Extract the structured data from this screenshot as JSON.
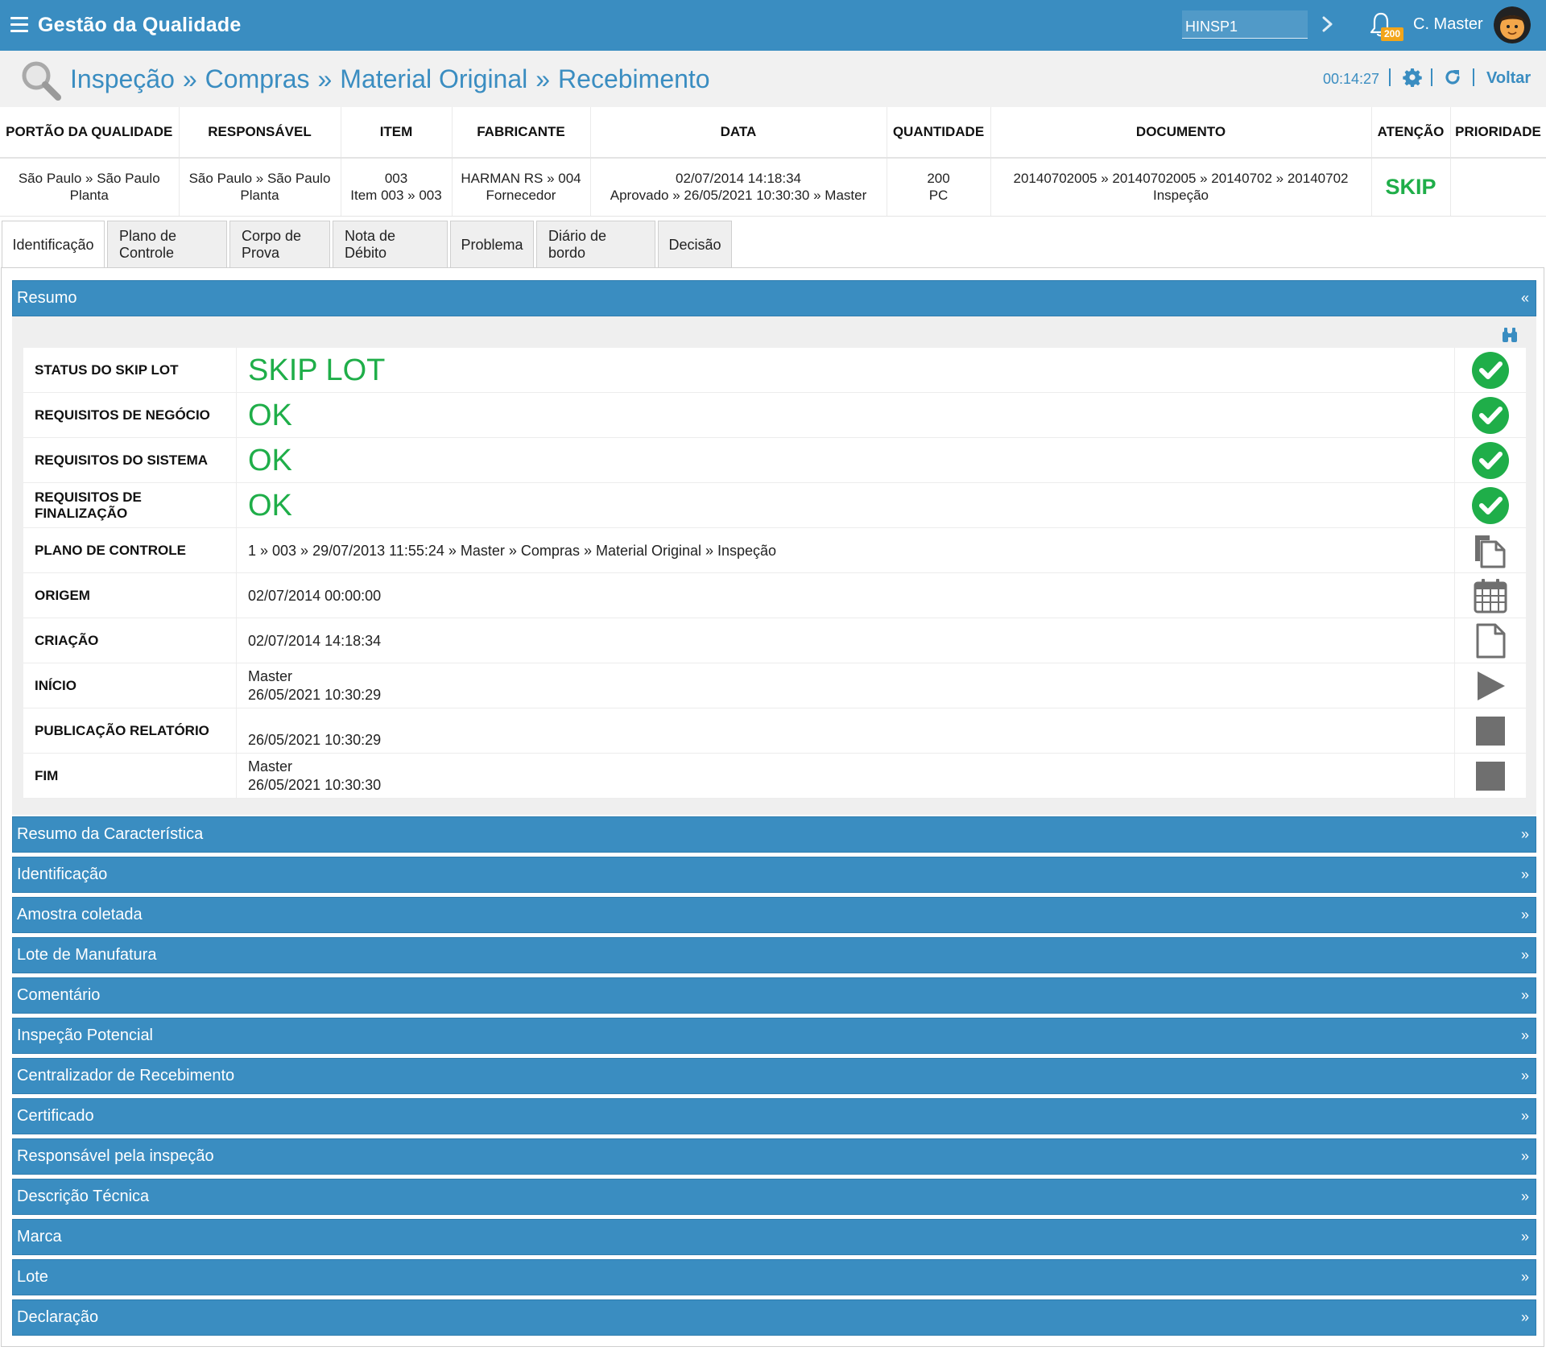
{
  "app": {
    "title": "Gestão da Qualidade",
    "company": "HINSP1",
    "notifications": "200",
    "user": "C. Master"
  },
  "breadcrumb": {
    "items": [
      "Inspeção",
      "Compras",
      "Material Original",
      "Recebimento"
    ],
    "separator": "»",
    "timer": "00:14:27",
    "back": "Voltar"
  },
  "summary": {
    "headers": [
      "PORTÃO DA QUALIDADE",
      "RESPONSÁVEL",
      "ITEM",
      "FABRICANTE",
      "DATA",
      "QUANTIDADE",
      "DOCUMENTO",
      "ATENÇÃO",
      "PRIORIDADE"
    ],
    "gate": {
      "l1": "São Paulo » São Paulo",
      "l2": "Planta"
    },
    "responsible": {
      "l1": "São Paulo » São Paulo",
      "l2": "Planta"
    },
    "item": {
      "l1": "003",
      "l2": "Item 003 » 003"
    },
    "manufacturer": {
      "l1": "HARMAN RS » 004",
      "l2": "Fornecedor"
    },
    "date": {
      "l1": "02/07/2014 14:18:34",
      "l2": "Aprovado » 26/05/2021 10:30:30 » Master"
    },
    "quantity": {
      "l1": "200",
      "l2": "PC"
    },
    "document": {
      "l1": "20140702005 » 20140702005 » 20140702 » 20140702",
      "l2": "Inspeção"
    },
    "attention": "SKIP",
    "priority": ""
  },
  "tabs": [
    "Identificação",
    "Plano de Controle",
    "Corpo de Prova",
    "Nota de Débito",
    "Problema",
    "Diário de bordo",
    "Decisão"
  ],
  "resumo": {
    "title": "Resumo",
    "collapse": "«",
    "rows": [
      {
        "label": "STATUS DO SKIP LOT",
        "value": "SKIP LOT",
        "icon": "check-circle-icon"
      },
      {
        "label": "REQUISITOS DE NEGÓCIO",
        "value": "OK",
        "icon": "check-circle-icon"
      },
      {
        "label": "REQUISITOS DO SISTEMA",
        "value": "OK",
        "icon": "check-circle-icon"
      },
      {
        "label": "REQUISITOS DE FINALIZAÇÃO",
        "value": "OK",
        "icon": "check-circle-icon"
      },
      {
        "label": "PLANO DE CONTROLE",
        "value": "1 » 003 » 29/07/2013 11:55:24 » Master » Compras » Material Original » Inspeção",
        "icon": "copy-icon"
      },
      {
        "label": "ORIGEM",
        "value": "02/07/2014 00:00:00",
        "icon": "calendar-icon"
      },
      {
        "label": "CRIAÇÃO",
        "value": "02/07/2014 14:18:34",
        "icon": "file-icon"
      },
      {
        "label": "INÍCIO",
        "l1": "Master",
        "l2": "26/05/2021 10:30:29",
        "icon": "play-icon"
      },
      {
        "label": "PUBLICAÇÃO RELATÓRIO",
        "l1": "",
        "l2": "26/05/2021 10:30:29",
        "icon": "stop-icon"
      },
      {
        "label": "FIM",
        "l1": "Master",
        "l2": "26/05/2021 10:30:30",
        "icon": "stop-icon"
      }
    ]
  },
  "sections": [
    "Resumo da Característica",
    "Identificação",
    "Amostra coletada",
    "Lote de Manufatura",
    "Comentário",
    "Inspeção Potencial",
    "Centralizador de Recebimento",
    "Certificado",
    "Responsável pela inspeção",
    "Descrição Técnica",
    "Marca",
    "Lote",
    "Declaração"
  ],
  "expand_symbol": "»",
  "colors": {
    "primary": "#3a8dc1",
    "ok_green": "#1fae49",
    "badge": "#f2a51a",
    "icon_gray": "#6f6f6f"
  }
}
